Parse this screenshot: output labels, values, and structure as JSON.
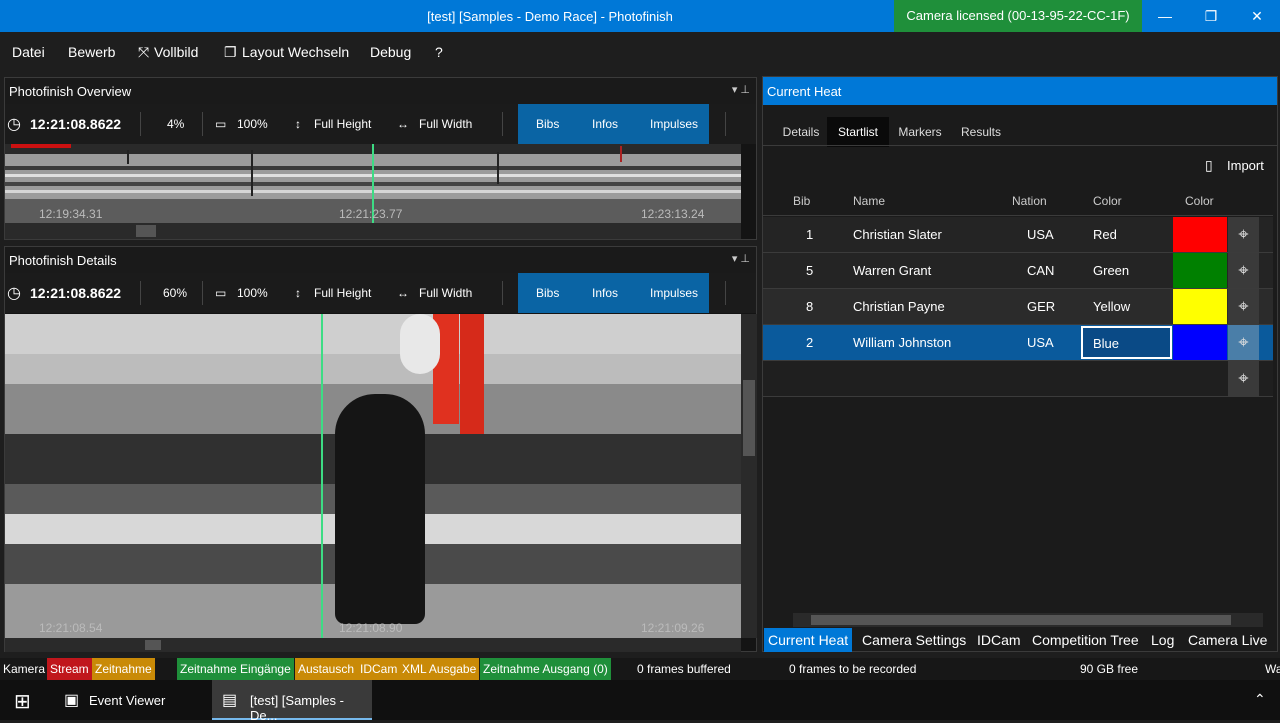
{
  "window": {
    "title": "[test] [Samples - Demo Race] - Photofinish",
    "license": "Camera licensed (00-13-95-22-CC-1F)",
    "minimize": "—",
    "restore": "❐",
    "close": "✕"
  },
  "menu": {
    "datei": "Datei",
    "bewerb": "Bewerb",
    "vollbild": "Vollbild",
    "layout": "Layout Wechseln",
    "debug": "Debug",
    "help": "?"
  },
  "overview": {
    "title": "Photofinish Overview",
    "time": "12:21:08.8622",
    "zoom": "4%",
    "scale": "100%",
    "full_height": "Full Height",
    "full_width": "Full Width",
    "bibs": "Bibs",
    "infos": "Infos",
    "impulses": "Impulses",
    "ticks": [
      "12:19:34.31",
      "12:21:23.77",
      "12:23:13.24"
    ]
  },
  "details": {
    "title": "Photofinish Details",
    "time": "12:21:08.8622",
    "zoom": "60%",
    "scale": "100%",
    "full_height": "Full Height",
    "full_width": "Full Width",
    "bibs": "Bibs",
    "infos": "Infos",
    "impulses": "Impulses",
    "ticks": [
      "12:21:08.54",
      "12:21:08.90",
      "12:21:09.26"
    ]
  },
  "heat": {
    "title": "Current Heat",
    "tabs": [
      "Details",
      "Startlist",
      "Markers",
      "Results"
    ],
    "active_tab": "Startlist",
    "import": "Import",
    "columns": [
      "Bib",
      "Name",
      "Nation",
      "Color",
      "Color"
    ],
    "rows": [
      {
        "bib": "1",
        "name": "Christian Slater",
        "nation": "USA",
        "color": "Red",
        "swatch": "#ff0000"
      },
      {
        "bib": "5",
        "name": "Warren Grant",
        "nation": "CAN",
        "color": "Green",
        "swatch": "#008000"
      },
      {
        "bib": "8",
        "name": "Christian Payne",
        "nation": "GER",
        "color": "Yellow",
        "swatch": "#ffff00"
      },
      {
        "bib": "2",
        "name": "William Johnston",
        "nation": "USA",
        "color": "Blue",
        "swatch": "#0000ff"
      }
    ],
    "bottom_tabs": [
      "Current Heat",
      "Camera Settings",
      "IDCam",
      "Competition Tree",
      "Log",
      "Camera Live"
    ]
  },
  "status": {
    "kamera": "Kamera",
    "stream": "Stream",
    "zeitnahme": "Zeitnahme",
    "eingaenge": "Zeitnahme Eingänge",
    "austausch": "Austausch",
    "idcam": "IDCam",
    "xml": "XML Ausgabe",
    "ausgang": "Zeitnahme Ausgang (0)",
    "buffered": "0 frames buffered",
    "to_record": "0 frames to be recorded",
    "free": "90 GB free",
    "wa": "Wa"
  },
  "taskbar": {
    "event_viewer": "Event Viewer",
    "app": "[test] [Samples - De..."
  }
}
